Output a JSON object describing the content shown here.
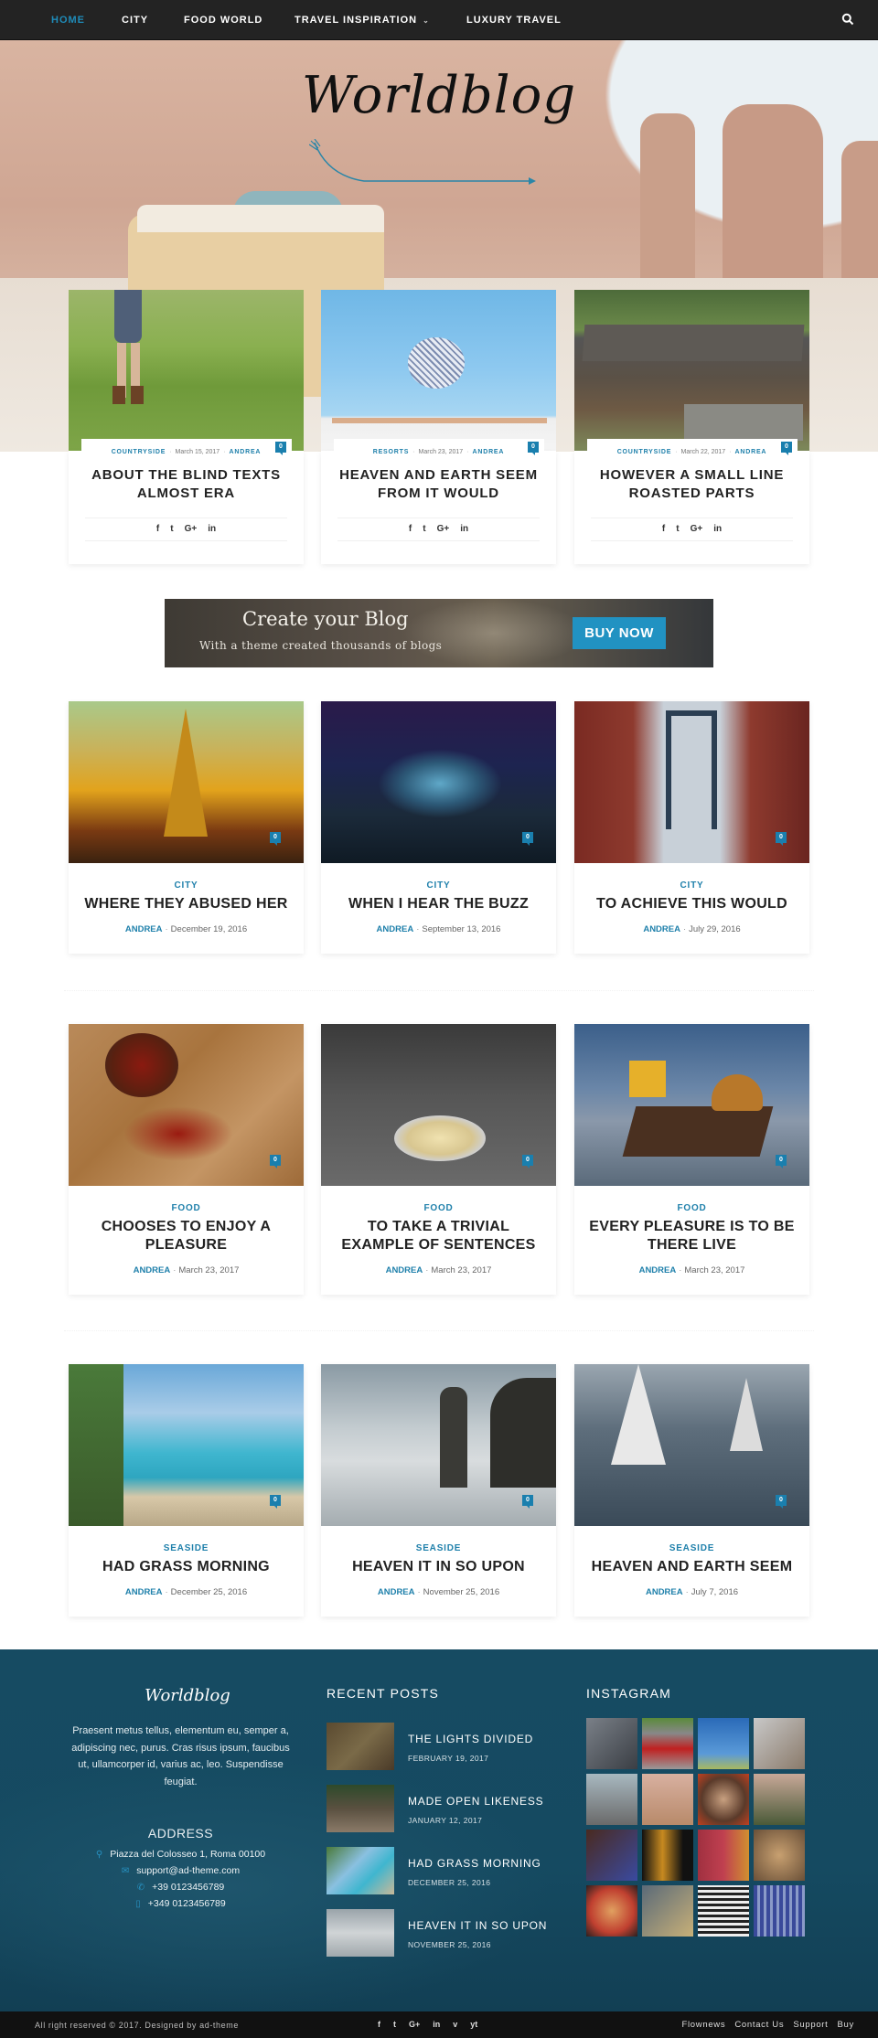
{
  "nav": {
    "items": [
      {
        "label": "HOME",
        "active": true
      },
      {
        "label": "CITY"
      },
      {
        "label": "FOOD WORLD"
      },
      {
        "label": "TRAVEL INSPIRATION",
        "has_dropdown": true
      },
      {
        "label": "LUXURY TRAVEL"
      }
    ],
    "search_icon": "search-icon",
    "dropdown_glyph": "⌄"
  },
  "brand": {
    "logo_text": "Worldblog",
    "accent_color": "#1f80ab",
    "button_color": "#2192c2"
  },
  "featured": [
    {
      "category": "COUNTRYSIDE",
      "date": "March 15, 2017",
      "author": "ANDREA",
      "title": "ABOUT THE BLIND TEXTS ALMOST ERA",
      "comments": "0",
      "share": [
        "f",
        "t",
        "G+",
        "in"
      ]
    },
    {
      "category": "RESORTS",
      "date": "March 23, 2017",
      "author": "ANDREA",
      "title": "HEAVEN AND EARTH SEEM FROM IT WOULD",
      "comments": "0",
      "share": [
        "f",
        "t",
        "G+",
        "in"
      ]
    },
    {
      "category": "COUNTRYSIDE",
      "date": "March 22, 2017",
      "author": "ANDREA",
      "title": "HOWEVER A SMALL LINE ROASTED PARTS",
      "comments": "0",
      "share": [
        "f",
        "t",
        "G+",
        "in"
      ]
    }
  ],
  "banner": {
    "title": "Create your Blog",
    "subtitle": "With a theme created thousands of blogs",
    "button": "BUY NOW"
  },
  "sections": [
    {
      "posts": [
        {
          "category": "CITY",
          "title": "WHERE THEY ABUSED HER",
          "author": "ANDREA",
          "date": "December 19, 2016",
          "comments": "0"
        },
        {
          "category": "CITY",
          "title": "WHEN I HEAR THE BUZZ",
          "author": "ANDREA",
          "date": "September 13, 2016",
          "comments": "0"
        },
        {
          "category": "CITY",
          "title": "TO ACHIEVE THIS WOULD",
          "author": "ANDREA",
          "date": "July 29, 2016",
          "comments": "0"
        }
      ]
    },
    {
      "posts": [
        {
          "category": "FOOD",
          "title": "CHOOSES TO ENJOY A PLEASURE",
          "author": "ANDREA",
          "date": "March 23, 2017",
          "comments": "0"
        },
        {
          "category": "FOOD",
          "title": "TO TAKE A TRIVIAL EXAMPLE OF SENTENCES",
          "author": "ANDREA",
          "date": "March 23, 2017",
          "comments": "0"
        },
        {
          "category": "FOOD",
          "title": "EVERY PLEASURE IS TO BE THERE LIVE",
          "author": "ANDREA",
          "date": "March 23, 2017",
          "comments": "0"
        }
      ]
    },
    {
      "posts": [
        {
          "category": "SEASIDE",
          "title": "HAD GRASS MORNING",
          "author": "ANDREA",
          "date": "December 25, 2016",
          "comments": "0"
        },
        {
          "category": "SEASIDE",
          "title": "HEAVEN IT IN SO UPON",
          "author": "ANDREA",
          "date": "November 25, 2016",
          "comments": "0"
        },
        {
          "category": "SEASIDE",
          "title": "HEAVEN AND EARTH SEEM",
          "author": "ANDREA",
          "date": "July 7, 2016",
          "comments": "0"
        }
      ]
    }
  ],
  "footer": {
    "logo_text": "Worldblog",
    "about": "Praesent metus tellus, elementum eu, semper a, adipiscing nec, purus. Cras risus ipsum, faucibus ut, ullamcorper id, varius ac, leo. Suspendisse feugiat.",
    "address_title": "ADDRESS",
    "address": [
      {
        "icon": "map-pin-icon",
        "glyph": "⚲",
        "text": "Piazza del Colosseo 1, Roma 00100"
      },
      {
        "icon": "envelope-icon",
        "glyph": "✉",
        "text": "support@ad-theme.com"
      },
      {
        "icon": "phone-icon",
        "glyph": "✆",
        "text": "+39 0123456789"
      },
      {
        "icon": "mobile-icon",
        "glyph": "▯",
        "text": "+349 0123456789"
      }
    ],
    "recent_title": "RECENT POSTS",
    "recent_posts": [
      {
        "title": "THE LIGHTS DIVIDED",
        "date": "FEBRUARY 19, 2017"
      },
      {
        "title": "MADE OPEN LIKENESS",
        "date": "JANUARY 12, 2017"
      },
      {
        "title": "HAD GRASS MORNING",
        "date": "DECEMBER 25, 2016"
      },
      {
        "title": "HEAVEN IT IN SO UPON",
        "date": "NOVEMBER 25, 2016"
      }
    ],
    "instagram_title": "INSTAGRAM",
    "instagram_count": 16
  },
  "bottom": {
    "copyright": "All right reserved © 2017. Designed by ad-theme",
    "social": [
      "f",
      "t",
      "G+",
      "in",
      "v",
      "yt"
    ],
    "links": [
      "Flownews",
      "Contact Us",
      "Support",
      "Buy"
    ]
  }
}
